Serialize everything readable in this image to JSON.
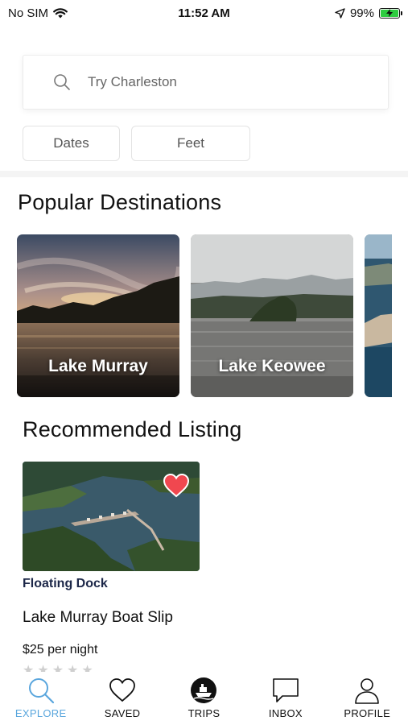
{
  "status_bar": {
    "carrier": "No SIM",
    "time": "11:52 AM",
    "battery": "99%"
  },
  "search": {
    "placeholder": "Try Charleston"
  },
  "filters": {
    "dates_label": "Dates",
    "feet_label": "Feet"
  },
  "popular": {
    "title": "Popular Destinations",
    "destinations": [
      {
        "name": "Lake Murray"
      },
      {
        "name": "Lake Keowee"
      }
    ]
  },
  "recommended": {
    "title": "Recommended Listing",
    "listing": {
      "type": "Floating Dock",
      "title": "Lake Murray Boat Slip",
      "price": "$25 per night",
      "rating": 0,
      "favorited": true
    }
  },
  "tabs": [
    {
      "label": "EXPLORE",
      "icon": "search-icon",
      "active": true
    },
    {
      "label": "SAVED",
      "icon": "heart-icon",
      "active": false
    },
    {
      "label": "TRIPS",
      "icon": "boat-icon",
      "active": false
    },
    {
      "label": "INBOX",
      "icon": "chat-bubble-icon",
      "active": false
    },
    {
      "label": "PROFILE",
      "icon": "person-icon",
      "active": false
    }
  ],
  "colors": {
    "accent": "#5aa6dd",
    "heart": "#f0474f",
    "listing_type": "#1c2748"
  }
}
